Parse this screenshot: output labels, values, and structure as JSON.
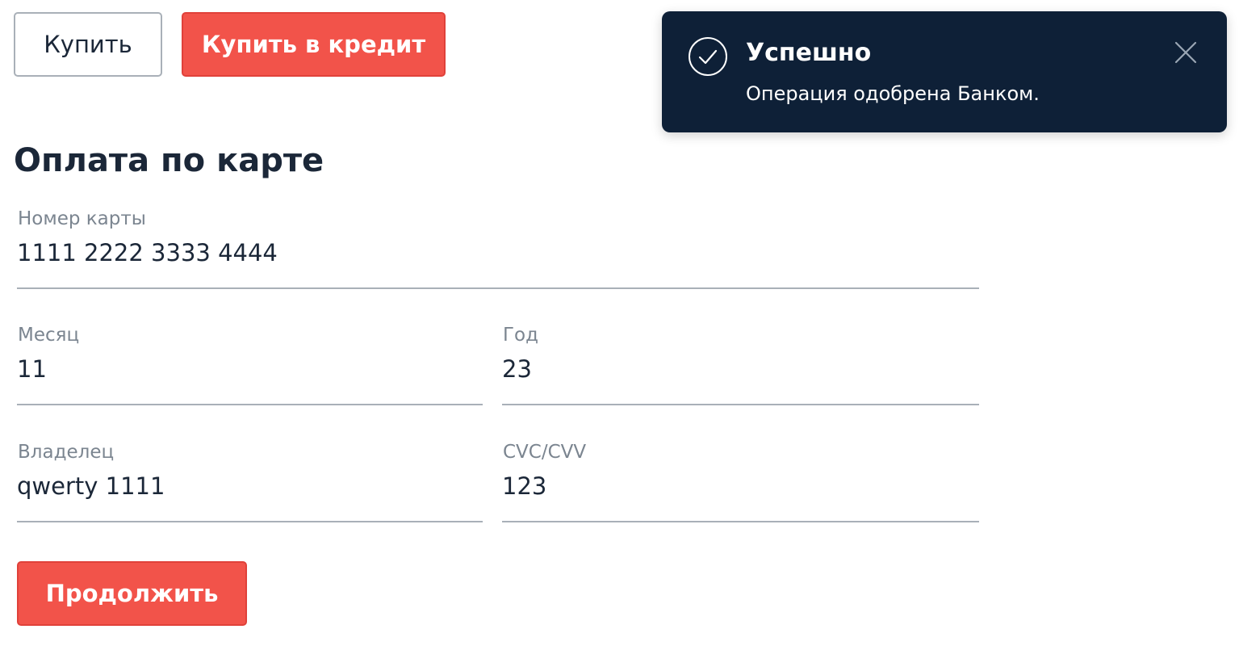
{
  "actions": {
    "buy_label": "Купить",
    "buy_credit_label": "Купить в кредит"
  },
  "form": {
    "title": "Оплата по карте",
    "card_number": {
      "label": "Номер карты",
      "value": "1111 2222 3333 4444"
    },
    "month": {
      "label": "Месяц",
      "value": "11"
    },
    "year": {
      "label": "Год",
      "value": "23"
    },
    "owner": {
      "label": "Владелец",
      "value": "qwerty 1111"
    },
    "cvc": {
      "label": "CVC/CVV",
      "value": "123"
    },
    "continue_label": "Продолжить"
  },
  "notification": {
    "icon": "check-circle-icon",
    "title": "Успешно",
    "message": "Операция одобрена Банком.",
    "close_icon": "close-icon"
  },
  "colors": {
    "accent": "#f2534a",
    "toast_background": "#0e2037",
    "text": "#1b2738",
    "muted": "#7b8590"
  }
}
